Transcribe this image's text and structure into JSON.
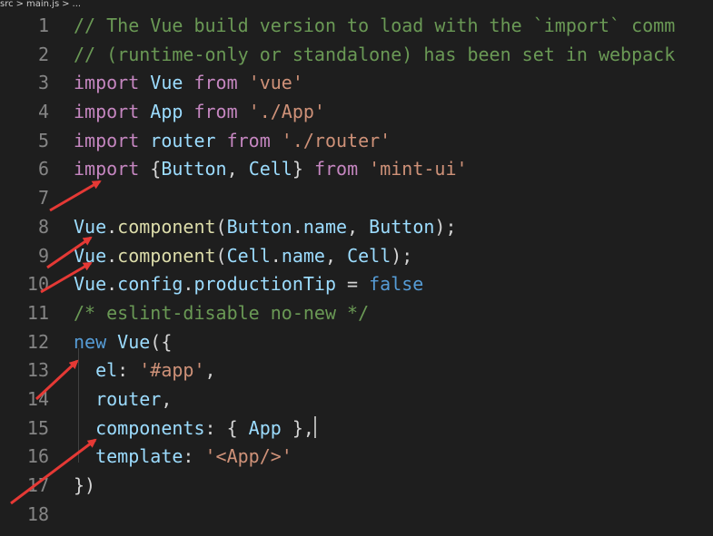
{
  "breadcrumb": {
    "folder": "src",
    "sep1": ">",
    "file": "main.js",
    "sep2": ">",
    "more": "..."
  },
  "colors": {
    "arrow": "#e53935",
    "background": "#1e1e1e"
  },
  "lines": [
    {
      "num": "1",
      "tokens": [
        {
          "t": "// The Vue build version to load with the `import` comm",
          "c": "comment"
        }
      ]
    },
    {
      "num": "2",
      "tokens": [
        {
          "t": "// (runtime-only or standalone) has been set in webpack",
          "c": "comment"
        }
      ]
    },
    {
      "num": "3",
      "tokens": [
        {
          "t": "import",
          "c": "keyword"
        },
        {
          "t": " Vue ",
          "c": "name"
        },
        {
          "t": "from",
          "c": "keyword"
        },
        {
          "t": " ",
          "c": "punct"
        },
        {
          "t": "'vue'",
          "c": "string"
        }
      ]
    },
    {
      "num": "4",
      "tokens": [
        {
          "t": "import",
          "c": "keyword"
        },
        {
          "t": " App ",
          "c": "name"
        },
        {
          "t": "from",
          "c": "keyword"
        },
        {
          "t": " ",
          "c": "punct"
        },
        {
          "t": "'./App'",
          "c": "string"
        }
      ]
    },
    {
      "num": "5",
      "tokens": [
        {
          "t": "import",
          "c": "keyword"
        },
        {
          "t": " router ",
          "c": "name"
        },
        {
          "t": "from",
          "c": "keyword"
        },
        {
          "t": " ",
          "c": "punct"
        },
        {
          "t": "'./router'",
          "c": "string"
        }
      ]
    },
    {
      "num": "6",
      "tokens": [
        {
          "t": "import",
          "c": "keyword"
        },
        {
          "t": " {",
          "c": "punct"
        },
        {
          "t": "Button",
          "c": "name"
        },
        {
          "t": ", ",
          "c": "punct"
        },
        {
          "t": "Cell",
          "c": "name"
        },
        {
          "t": "} ",
          "c": "punct"
        },
        {
          "t": "from",
          "c": "keyword"
        },
        {
          "t": " ",
          "c": "punct"
        },
        {
          "t": "'mint-ui'",
          "c": "string"
        }
      ]
    },
    {
      "num": "7",
      "tokens": []
    },
    {
      "num": "8",
      "tokens": [
        {
          "t": "Vue",
          "c": "name"
        },
        {
          "t": ".",
          "c": "punct"
        },
        {
          "t": "component",
          "c": "func"
        },
        {
          "t": "(",
          "c": "punct"
        },
        {
          "t": "Button",
          "c": "name"
        },
        {
          "t": ".",
          "c": "punct"
        },
        {
          "t": "name",
          "c": "name"
        },
        {
          "t": ", ",
          "c": "punct"
        },
        {
          "t": "Button",
          "c": "name"
        },
        {
          "t": ");",
          "c": "punct"
        }
      ]
    },
    {
      "num": "9",
      "tokens": [
        {
          "t": "Vue",
          "c": "name"
        },
        {
          "t": ".",
          "c": "punct"
        },
        {
          "t": "component",
          "c": "func"
        },
        {
          "t": "(",
          "c": "punct"
        },
        {
          "t": "Cell",
          "c": "name"
        },
        {
          "t": ".",
          "c": "punct"
        },
        {
          "t": "name",
          "c": "name"
        },
        {
          "t": ", ",
          "c": "punct"
        },
        {
          "t": "Cell",
          "c": "name"
        },
        {
          "t": ");",
          "c": "punct"
        }
      ]
    },
    {
      "num": "10",
      "tokens": [
        {
          "t": "Vue",
          "c": "name"
        },
        {
          "t": ".",
          "c": "punct"
        },
        {
          "t": "config",
          "c": "name"
        },
        {
          "t": ".",
          "c": "punct"
        },
        {
          "t": "productionTip",
          "c": "name"
        },
        {
          "t": " = ",
          "c": "punct"
        },
        {
          "t": "false",
          "c": "const"
        }
      ]
    },
    {
      "num": "11",
      "tokens": [
        {
          "t": "/* eslint-disable no-new */",
          "c": "comment"
        }
      ]
    },
    {
      "num": "12",
      "tokens": [
        {
          "t": "new",
          "c": "const"
        },
        {
          "t": " ",
          "c": "punct"
        },
        {
          "t": "Vue",
          "c": "name"
        },
        {
          "t": "({",
          "c": "punct"
        }
      ]
    },
    {
      "num": "13",
      "tokens": [
        {
          "t": "  el",
          "c": "name"
        },
        {
          "t": ": ",
          "c": "punct"
        },
        {
          "t": "'#app'",
          "c": "string"
        },
        {
          "t": ",",
          "c": "punct"
        }
      ]
    },
    {
      "num": "14",
      "tokens": [
        {
          "t": "  router",
          "c": "name"
        },
        {
          "t": ",",
          "c": "punct"
        }
      ]
    },
    {
      "num": "15",
      "tokens": [
        {
          "t": "  components",
          "c": "name"
        },
        {
          "t": ": { ",
          "c": "punct"
        },
        {
          "t": "App",
          "c": "name"
        },
        {
          "t": " },",
          "c": "punct"
        }
      ],
      "cursor": true
    },
    {
      "num": "16",
      "tokens": [
        {
          "t": "  template",
          "c": "name"
        },
        {
          "t": ": ",
          "c": "punct"
        },
        {
          "t": "'<App/>'",
          "c": "string"
        }
      ]
    },
    {
      "num": "17",
      "tokens": [
        {
          "t": "})",
          "c": "punct"
        }
      ]
    },
    {
      "num": "18",
      "tokens": []
    }
  ]
}
